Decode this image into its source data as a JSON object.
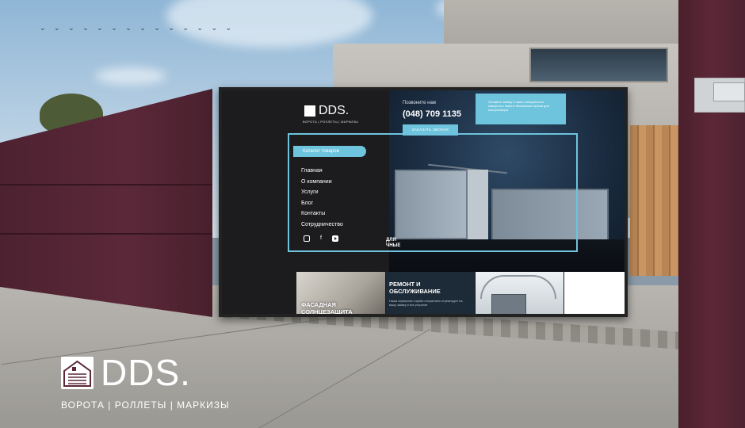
{
  "colors": {
    "accent": "#6ec3dd",
    "gate": "#5b2839",
    "screen_bg": "#1c1c1f"
  },
  "brand": {
    "icon": "house-gate-logo-icon",
    "name": "DDS.",
    "tagline": "ВОРОТА | РОЛЛЕТЫ | МАРКИЗЫ"
  },
  "website": {
    "logo": {
      "name": "DDS.",
      "tagline": "ВОРОТА | РОЛЛЕТЫ | МАРКИЗЫ"
    },
    "header": {
      "call_label": "Позвоните нам",
      "phone": "(048) 709 1135",
      "call_button": "ЗАКАЗАТЬ ЗВОНОК"
    },
    "promo_text": "Оставьте заявку и наши специалисты свяжутся с вами в ближайшее время для консультации.",
    "sidebar": {
      "catalog_label": "Каталог товаров",
      "menu": [
        "Главная",
        "О компании",
        "Услуги",
        "Блог",
        "Контакты",
        "Сотрудничество"
      ],
      "socials": [
        "instagram-icon",
        "facebook-icon",
        "youtube-icon"
      ]
    },
    "hero_caption_line1": "ДЛЯ",
    "hero_caption_line2": "ЧНЫЕ",
    "cards": [
      {
        "title_line1": "ФАСАДНАЯ",
        "title_line2": "СОЛНЦЕЗАЩИТА"
      },
      {
        "title_line1": "РЕМОНТ И",
        "title_line2": "ОБСЛУЖИВАНИЕ",
        "text": "Наша сервисная служба оперативно отреагирует на вашу заявку и все устранит"
      },
      {
        "title_line1": "",
        "title_line2": ""
      },
      {
        "title_line1": "",
        "title_line2": ""
      }
    ]
  }
}
